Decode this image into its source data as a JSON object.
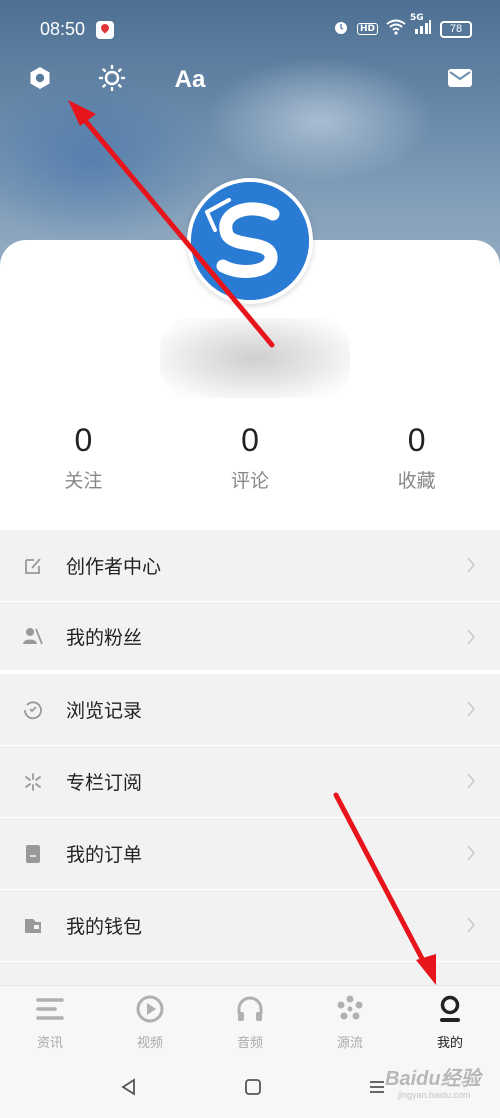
{
  "status_bar": {
    "time": "08:50",
    "network": "5G",
    "hd_label": "HD",
    "battery": "78"
  },
  "toolbar": {
    "font_size_label": "Aa"
  },
  "profile": {
    "stats": [
      {
        "value": "0",
        "label": "关注"
      },
      {
        "value": "0",
        "label": "评论"
      },
      {
        "value": "0",
        "label": "收藏"
      }
    ]
  },
  "menu": {
    "items": [
      {
        "label": "创作者中心",
        "icon": "edit-icon"
      },
      {
        "label": "我的粉丝",
        "icon": "fans-icon"
      },
      {
        "label": "浏览记录",
        "icon": "history-icon"
      },
      {
        "label": "专栏订阅",
        "icon": "subscription-icon"
      },
      {
        "label": "我的订单",
        "icon": "order-icon"
      },
      {
        "label": "我的钱包",
        "icon": "wallet-icon"
      }
    ]
  },
  "bottom_nav": {
    "items": [
      {
        "label": "资讯",
        "icon": "news-icon"
      },
      {
        "label": "视频",
        "icon": "video-icon"
      },
      {
        "label": "音频",
        "icon": "audio-icon"
      },
      {
        "label": "源流",
        "icon": "source-icon"
      },
      {
        "label": "我的",
        "icon": "profile-icon",
        "active": true
      }
    ]
  },
  "watermark": {
    "text": "Baidu经验",
    "sub": "jingyan.baidu.com"
  },
  "colors": {
    "annotation_arrow": "#e8141b",
    "avatar_blue": "#2a7bd4",
    "active_nav": "#222222",
    "inactive_nav": "#aaaaaa"
  }
}
